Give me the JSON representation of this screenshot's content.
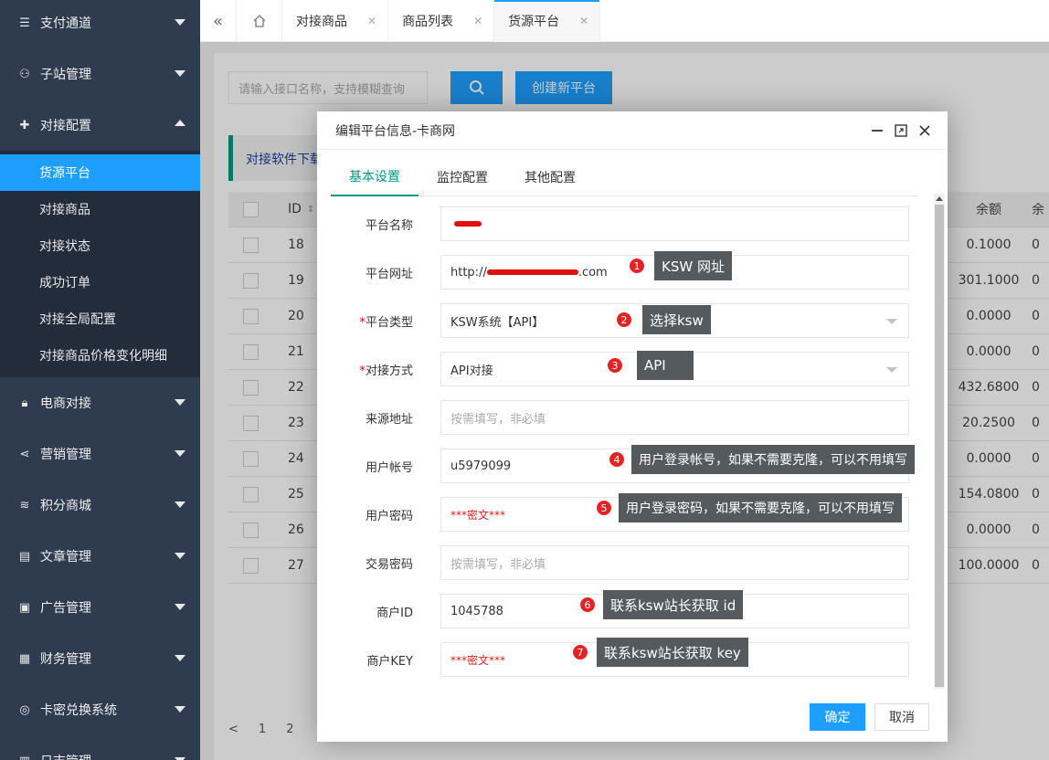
{
  "sidebar": {
    "top_items": [
      {
        "label": "支付通道",
        "icon": "list-icon"
      },
      {
        "label": "子站管理",
        "icon": "users-icon"
      },
      {
        "label": "对接配置",
        "icon": "puzzle-icon",
        "expanded": true
      }
    ],
    "sub_items": [
      {
        "label": "货源平台",
        "active": true
      },
      {
        "label": "对接商品"
      },
      {
        "label": "对接状态"
      },
      {
        "label": "成功订单"
      },
      {
        "label": "对接全局配置"
      },
      {
        "label": "对接商品价格变化明细"
      }
    ],
    "bottom_items": [
      {
        "label": "电商对接",
        "icon": "lock-icon"
      },
      {
        "label": "营销管理",
        "icon": "share-icon"
      },
      {
        "label": "积分商城",
        "icon": "database-icon"
      },
      {
        "label": "文章管理",
        "icon": "document-icon"
      },
      {
        "label": "广告管理",
        "icon": "image-icon"
      },
      {
        "label": "财务管理",
        "icon": "finance-icon"
      },
      {
        "label": "卡密兑换系统",
        "icon": "target-icon"
      },
      {
        "label": "日志管理",
        "icon": "log-icon"
      }
    ]
  },
  "tabs": [
    {
      "label": "对接商品"
    },
    {
      "label": "商品列表"
    },
    {
      "label": "货源平台",
      "active": true
    }
  ],
  "toolbar": {
    "search_placeholder": "请输入接口名称，支持模糊查询",
    "create_label": "创建新平台",
    "notice_text": "对接软件下载"
  },
  "table": {
    "id_header": "ID",
    "balance_header": "余额",
    "balance_header2": "余",
    "rows": [
      {
        "id": "18",
        "balance": "0.1000",
        "tail": "0"
      },
      {
        "id": "19",
        "balance": "301.1000",
        "tail": "0"
      },
      {
        "id": "20",
        "balance": "0.0000",
        "tail": "0"
      },
      {
        "id": "21",
        "balance": "0.0000",
        "tail": "0"
      },
      {
        "id": "22",
        "balance": "432.6800",
        "tail": "0"
      },
      {
        "id": "23",
        "balance": "20.2500",
        "tail": "0"
      },
      {
        "id": "24",
        "balance": "0.0000",
        "tail": "0"
      },
      {
        "id": "25",
        "balance": "154.0800",
        "tail": "0"
      },
      {
        "id": "26",
        "balance": "0.0000",
        "tail": "0"
      },
      {
        "id": "27",
        "balance": "100.0000",
        "tail": "0"
      }
    ]
  },
  "pager": {
    "prev": "<",
    "pages": [
      "1",
      "2"
    ]
  },
  "dialog": {
    "title": "编辑平台信息-卡商网",
    "tabs": [
      "基本设置",
      "监控配置",
      "其他配置"
    ],
    "fields": [
      {
        "label": "平台名称",
        "required": false,
        "value": "",
        "redacted": true
      },
      {
        "label": "平台网址",
        "required": false,
        "value": "http://",
        "value_tail": ".com",
        "redacted": true
      },
      {
        "label": "平台类型",
        "required": true,
        "value": "KSW系统【API】",
        "select": true
      },
      {
        "label": "对接方式",
        "required": true,
        "value": "API对接",
        "select": true
      },
      {
        "label": "来源地址",
        "required": false,
        "placeholder": "按需填写，非必填"
      },
      {
        "label": "用户帐号",
        "required": false,
        "value": "u5979099"
      },
      {
        "label": "用户密码",
        "required": false,
        "value": "***密文***",
        "secret": true
      },
      {
        "label": "交易密码",
        "required": false,
        "placeholder": "按需填写，非必填"
      },
      {
        "label": "商户ID",
        "required": false,
        "value": "1045788"
      },
      {
        "label": "商户KEY",
        "required": false,
        "value": "***密文***",
        "secret": true
      }
    ],
    "ok_label": "确定",
    "cancel_label": "取消"
  },
  "annotations": [
    {
      "num": "1",
      "text": "KSW 网址"
    },
    {
      "num": "2",
      "text": "选择ksw"
    },
    {
      "num": "3",
      "text": "API"
    },
    {
      "num": "4",
      "text": "用户登录帐号，如果不需要克隆，可以不用填写"
    },
    {
      "num": "5",
      "text": "用户登录密码，如果不需要克隆，可以不用填写"
    },
    {
      "num": "6",
      "text": "联系ksw站长获取 id"
    },
    {
      "num": "7",
      "text": "联系ksw站长获取 key"
    }
  ],
  "colors": {
    "accent": "#1e9fff",
    "sidebar": "#2f3b4f",
    "tab_active": "#009688",
    "annotation_bg": "#555a5f",
    "badge": "#e32424"
  }
}
